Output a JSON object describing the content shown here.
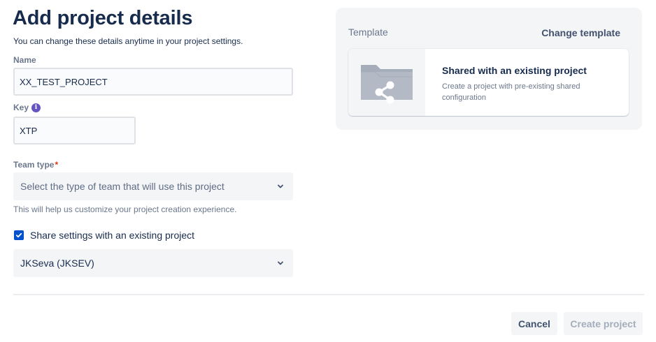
{
  "header": {
    "title": "Add project details",
    "subtitle": "You can change these details anytime in your project settings."
  },
  "form": {
    "name": {
      "label": "Name",
      "value": "XX_TEST_PROJECT"
    },
    "key": {
      "label": "Key",
      "value": "XTP",
      "info_icon": "info-icon"
    },
    "team_type": {
      "label": "Team type",
      "required_marker": "*",
      "placeholder": "Select the type of team that will use this project",
      "helper": "This will help us customize your project creation experience."
    },
    "share_settings": {
      "label": "Share settings with an existing project",
      "checked": true
    },
    "existing_project": {
      "value": "JKSeva (JKSEV)"
    }
  },
  "template": {
    "label": "Template",
    "change_label": "Change template",
    "card": {
      "name": "Shared with an existing project",
      "description": "Create a project with pre-existing shared configuration",
      "icon": "shared-folder-icon"
    }
  },
  "footer": {
    "cancel_label": "Cancel",
    "create_label": "Create project"
  },
  "colors": {
    "primary": "#0052cc",
    "text": "#172b4d",
    "subtle_text": "#6b778c",
    "info": "#6554c0",
    "required": "#de350b"
  }
}
